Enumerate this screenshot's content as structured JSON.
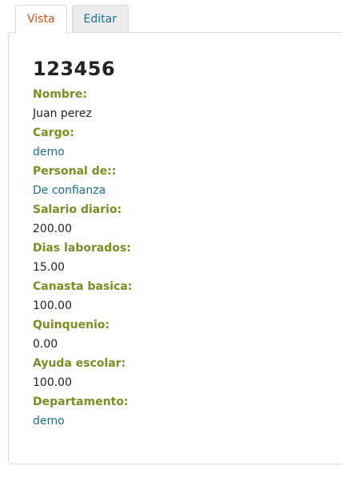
{
  "tabs": [
    {
      "label": "Vista",
      "active": true
    },
    {
      "label": "Editar",
      "active": false
    }
  ],
  "record": {
    "title": "123456",
    "fields": [
      {
        "label": "Nombre:",
        "value": "Juan perez",
        "link": false
      },
      {
        "label": "Cargo:",
        "value": "demo",
        "link": true
      },
      {
        "label": "Personal de::",
        "value": "De confianza",
        "link": true
      },
      {
        "label": "Salario diario:",
        "value": "200.00",
        "link": false
      },
      {
        "label": "Dias laborados:",
        "value": "15.00",
        "link": false
      },
      {
        "label": "Canasta basica:",
        "value": "100.00",
        "link": false
      },
      {
        "label": "Quinquenio:",
        "value": "0.00",
        "link": false
      },
      {
        "label": "Ayuda escolar:",
        "value": "100.00",
        "link": false
      },
      {
        "label": "Departamento:",
        "value": "demo",
        "link": true
      }
    ]
  },
  "colors": {
    "label": "#7a8e22",
    "link": "#1f6f87",
    "active_tab": "#d0531b"
  }
}
